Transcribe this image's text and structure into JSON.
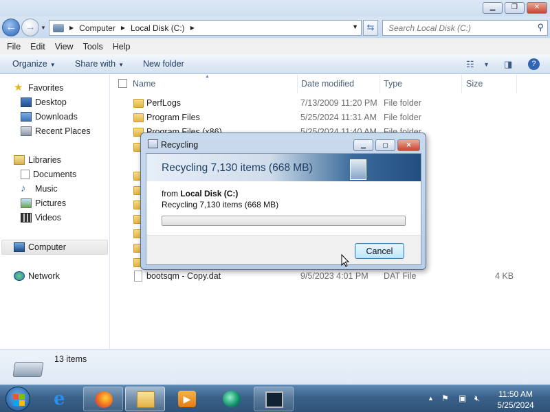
{
  "window": {
    "address": {
      "crumbs": [
        "Computer",
        "Local Disk (C:)"
      ]
    },
    "search_placeholder": "Search Local Disk (C:)"
  },
  "menu": [
    "File",
    "Edit",
    "View",
    "Tools",
    "Help"
  ],
  "commands": {
    "organize": "Organize",
    "share_with": "Share with",
    "new_folder": "New folder"
  },
  "nav": {
    "favorites": "Favorites",
    "favorites_items": [
      "Desktop",
      "Downloads",
      "Recent Places"
    ],
    "libraries": "Libraries",
    "libraries_items": [
      "Documents",
      "Music",
      "Pictures",
      "Videos"
    ],
    "computer": "Computer",
    "network": "Network"
  },
  "columns": {
    "name": "Name",
    "date": "Date modified",
    "type": "Type",
    "size": "Size"
  },
  "files": [
    {
      "name": "PerfLogs",
      "date": "7/13/2009 11:20 PM",
      "type": "File folder",
      "size": ""
    },
    {
      "name": "Program Files",
      "date": "5/25/2024 11:31 AM",
      "type": "File folder",
      "size": ""
    },
    {
      "name": "Program Files (x86)",
      "date": "5/25/2024 11:40 AM",
      "type": "File folder",
      "size": ""
    },
    {
      "name": "bootsqm - Copy.dat",
      "date": "9/5/2023 4:01 PM",
      "type": "DAT File",
      "size": "4 KB"
    }
  ],
  "status": {
    "item_count": "13 items"
  },
  "dialog": {
    "title": "Recycling",
    "heading": "Recycling 7,130 items (668 MB)",
    "from_prefix": "from",
    "from_location": "Local Disk (C:)",
    "detail": "Recycling 7,130 items (668 MB)",
    "progress": 0.0,
    "cancel_label": "Cancel"
  },
  "taskbar": {
    "apps": [
      "internet-explorer",
      "firefox",
      "windows-explorer",
      "media-player",
      "app-teal",
      "task-manager"
    ],
    "clock_time": "11:50 AM",
    "clock_date": "5/25/2024"
  },
  "colors": {
    "accent": "#1e395b",
    "dialog_heading": "#1e3f66",
    "taskbar": "#3a6189"
  }
}
